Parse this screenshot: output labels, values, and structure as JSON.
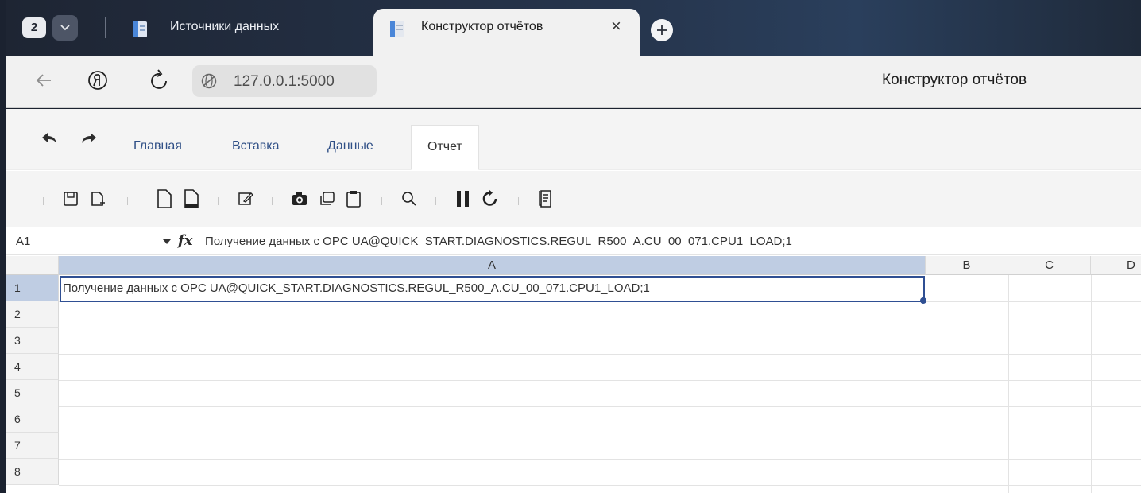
{
  "browser": {
    "tab_count": "2",
    "tabs": [
      {
        "label": "Источники данных",
        "active": false
      },
      {
        "label": "Конструктор отчётов",
        "active": true
      }
    ],
    "close_glyph": "×",
    "address": "127.0.0.1:5000",
    "page_title": "Конструктор отчётов",
    "icons": [
      "tab-count",
      "tabs-menu-chevron-icon",
      "document-icon",
      "close-icon",
      "plus-icon",
      "back-arrow-icon",
      "yandex-icon",
      "reload-icon",
      "globe-icon"
    ]
  },
  "app": {
    "menu": [
      "Главная",
      "Вставка",
      "Данные",
      "Отчет"
    ],
    "active_menu": "Отчет",
    "toolbar_icons": [
      "save-icon",
      "new-file-icon",
      "page-blank-icon",
      "page-footer-icon",
      "edit-icon",
      "camera-icon",
      "copy-icon",
      "paste-icon",
      "search-icon",
      "pause-icon",
      "refresh-icon",
      "report-icon"
    ],
    "formula_bar": {
      "cell_ref": "A1",
      "fx_label": "fx",
      "value": "Получение данных с OPC UA@QUICK_START.DIAGNOSTICS.REGUL_R500_A.CU_00_071.CPU1_LOAD;1"
    },
    "sheet": {
      "columns": [
        "A",
        "B",
        "C",
        "D"
      ],
      "rows": [
        "1",
        "2",
        "3",
        "4",
        "5",
        "6",
        "7",
        "8"
      ],
      "cells": {
        "A1": "Получение данных с OPC UA@QUICK_START.DIAGNOSTICS.REGUL_R500_A.CU_00_071.CPU1_LOAD;1"
      },
      "selected_cell": "A1"
    }
  },
  "colors": {
    "accent": "#2f4f93",
    "header_selected": "#bfcde3",
    "menu_text": "#2f4f86"
  }
}
